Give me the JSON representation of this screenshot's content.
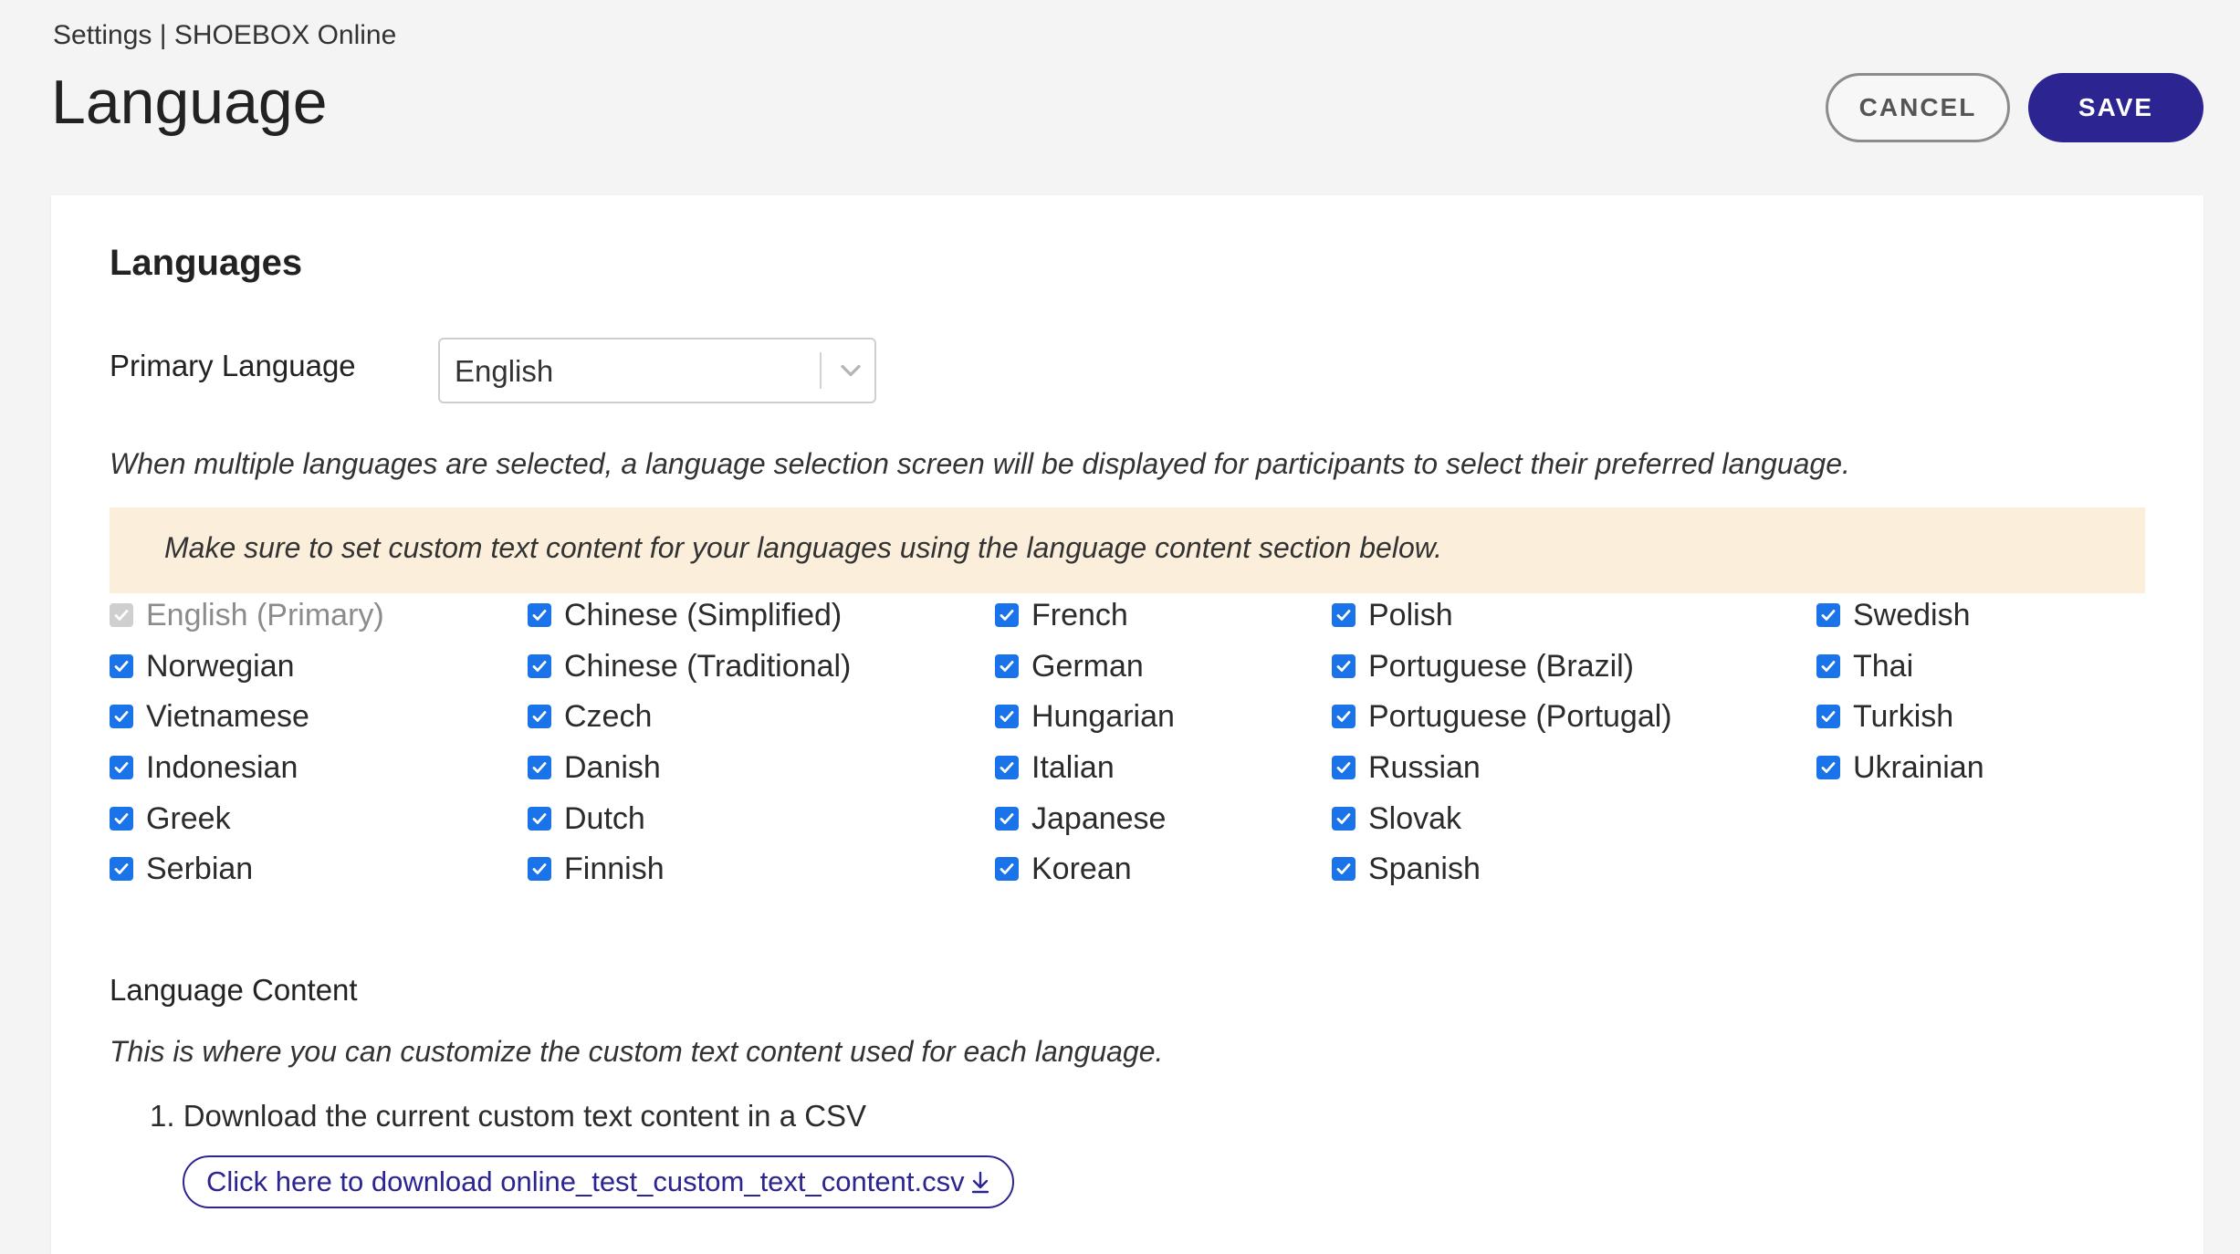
{
  "breadcrumb": "Settings | SHOEBOX Online",
  "page_title": "Language",
  "actions": {
    "cancel_label": "CANCEL",
    "save_label": "SAVE"
  },
  "colors": {
    "primary": "#2c2491",
    "checkbox": "#1a73e8",
    "banner_bg": "#fbefdc"
  },
  "languages_section": {
    "title": "Languages",
    "primary_language_label": "Primary Language",
    "primary_language_value": "English",
    "info_text": "When multiple languages are selected, a language selection screen will be displayed for participants to select their preferred language.",
    "banner_text": "Make sure to set custom text content for your languages using the language content section below.",
    "columns": [
      [
        {
          "label": "English (Primary)",
          "checked": true,
          "disabled": true
        },
        {
          "label": "Norwegian",
          "checked": true,
          "disabled": false
        },
        {
          "label": "Vietnamese",
          "checked": true,
          "disabled": false
        },
        {
          "label": "Indonesian",
          "checked": true,
          "disabled": false
        },
        {
          "label": "Greek",
          "checked": true,
          "disabled": false
        },
        {
          "label": "Serbian",
          "checked": true,
          "disabled": false
        }
      ],
      [
        {
          "label": "Chinese (Simplified)",
          "checked": true,
          "disabled": false
        },
        {
          "label": "Chinese (Traditional)",
          "checked": true,
          "disabled": false
        },
        {
          "label": "Czech",
          "checked": true,
          "disabled": false
        },
        {
          "label": "Danish",
          "checked": true,
          "disabled": false
        },
        {
          "label": "Dutch",
          "checked": true,
          "disabled": false
        },
        {
          "label": "Finnish",
          "checked": true,
          "disabled": false
        }
      ],
      [
        {
          "label": "French",
          "checked": true,
          "disabled": false
        },
        {
          "label": "German",
          "checked": true,
          "disabled": false
        },
        {
          "label": "Hungarian",
          "checked": true,
          "disabled": false
        },
        {
          "label": "Italian",
          "checked": true,
          "disabled": false
        },
        {
          "label": "Japanese",
          "checked": true,
          "disabled": false
        },
        {
          "label": "Korean",
          "checked": true,
          "disabled": false
        }
      ],
      [
        {
          "label": "Polish",
          "checked": true,
          "disabled": false
        },
        {
          "label": "Portuguese (Brazil)",
          "checked": true,
          "disabled": false
        },
        {
          "label": "Portuguese (Portugal)",
          "checked": true,
          "disabled": false
        },
        {
          "label": "Russian",
          "checked": true,
          "disabled": false
        },
        {
          "label": "Slovak",
          "checked": true,
          "disabled": false
        },
        {
          "label": "Spanish",
          "checked": true,
          "disabled": false
        }
      ],
      [
        {
          "label": "Swedish",
          "checked": true,
          "disabled": false
        },
        {
          "label": "Thai",
          "checked": true,
          "disabled": false
        },
        {
          "label": "Turkish",
          "checked": true,
          "disabled": false
        },
        {
          "label": "Ukrainian",
          "checked": true,
          "disabled": false
        }
      ]
    ]
  },
  "language_content": {
    "title": "Language Content",
    "description": "This is where you can customize the custom text content used for each language.",
    "step_1": "1. Download the current custom text content in a CSV",
    "download_label": "Click here to download online_test_custom_text_content.csv",
    "download_icon": "download-arrow-icon"
  }
}
